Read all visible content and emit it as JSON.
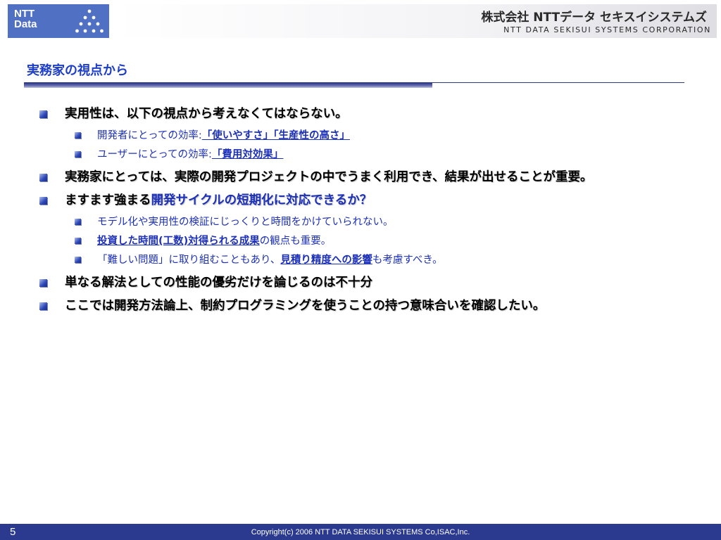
{
  "header": {
    "logo_text": "NTT Data",
    "logo_icon": "pyramid-dots-icon",
    "company_name_jp": "株式会社 NTTデータ セキスイシステムズ",
    "company_name_en": "NTT DATA SEKISUI SYSTEMS CORPORATION"
  },
  "slide": {
    "title": "実務家の視点から",
    "bullets": [
      {
        "text": "実用性は、以下の視点から考えなくてはならない。",
        "children": [
          {
            "pre": "開発者にとっての効率:",
            "em": "「使いやすさ」「生産性の高さ」",
            "post": ""
          },
          {
            "pre": "ユーザーにとっての効率:",
            "em": "「費用対効果」",
            "post": ""
          }
        ]
      },
      {
        "text": "実務家にとっては、実際の開発プロジェクトの中でうまく利用でき、結果が出せることが重要。"
      },
      {
        "pre": "ますます強まる",
        "em": "開発サイクルの短期化に対応できるか？",
        "children": [
          {
            "pre": "モデル化や実用性の検証にじっくりと時間をかけていられない。",
            "em": "",
            "post": ""
          },
          {
            "pre": "",
            "em": "投資した時間(工数)対得られる成果",
            "post": "の観点も重要。"
          },
          {
            "pre": "「難しい問題」に取り組むこともあり、",
            "em": "見積り精度への影響",
            "post": "も考慮すべき。"
          }
        ]
      },
      {
        "text": "単なる解法としての性能の優劣だけを論じるのは不十分"
      },
      {
        "text": "ここでは開発方法論上、制約プログラミングを使うことの持つ意味合いを確認したい。"
      }
    ]
  },
  "footer": {
    "page_number": "5",
    "copyright": "Copyright(c) 2006 NTT DATA SEKISUI SYSTEMS Co,ISAC,Inc."
  },
  "colors": {
    "accent_blue": "#1c30b8",
    "footer_bar": "#2b3a8f",
    "logo_bg": "#5070c4"
  }
}
